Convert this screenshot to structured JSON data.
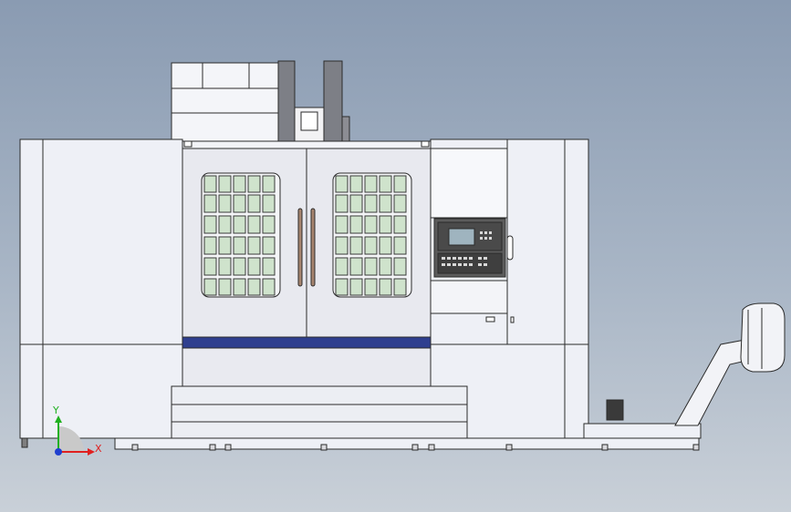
{
  "viewport": {
    "background_top": "#8a9bb2",
    "background_bottom": "#c9d0d8"
  },
  "machine": {
    "body_color": "#eef0f6",
    "panel_color": "#e9eaf0",
    "glass_color": "#cfe3cc",
    "accent_stripe_color": "#2f3f8f",
    "outline_color": "#2b2b2b",
    "cnc_screen_color": "#9fb4bf",
    "control_panel_color": "#5c5c5c"
  },
  "triad": {
    "y_label": "Y",
    "x_label": "X",
    "y_color": "#1fb01f",
    "x_color": "#e02020",
    "origin_color": "#1f3fcf"
  }
}
